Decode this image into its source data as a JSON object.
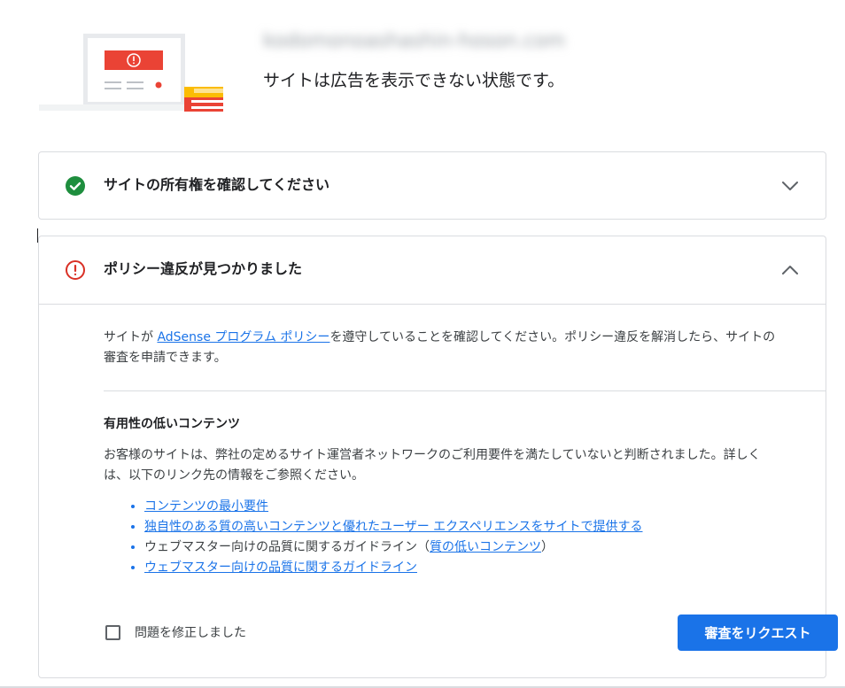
{
  "header": {
    "site_domain": "kodomonoashashin-hoson.com",
    "status_message": "サイトは広告を表示できない状態です。",
    "illustration_icon": "monitor-warning-icon"
  },
  "cards": {
    "ownership": {
      "title": "サイトの所有権を確認してください",
      "status": "complete",
      "status_icon": "check-circle-icon",
      "status_color": "#1e8e3e",
      "expanded": false
    },
    "policy": {
      "title": "ポリシー違反が見つかりました",
      "status": "error",
      "status_icon": "error-circle-icon",
      "status_color": "#d93025",
      "expanded": true,
      "intro_before": "サイトが ",
      "intro_link": "AdSense プログラム ポリシー",
      "intro_after": "を遵守していることを確認してください。ポリシー違反を解消したら、サイトの審査を申請できます。",
      "issue_title": "有用性の低いコンテンツ",
      "issue_description": "お客様のサイトは、弊社の定めるサイト運営者ネットワークのご利用要件を満たしていないと判断されました。詳しくは、以下のリンク先の情報をご参照ください。",
      "references": [
        {
          "link": "コンテンツの最小要件"
        },
        {
          "link": "独自性のある質の高いコンテンツと優れたユーザー エクスペリエンスをサイトで提供する"
        },
        {
          "prefix": "ウェブマスター向けの品質に関するガイドライン（",
          "link": "質の低いコンテンツ",
          "suffix": "）"
        },
        {
          "link": "ウェブマスター向けの品質に関するガイドライン"
        }
      ],
      "checkbox_label": "問題を修正しました",
      "checkbox_checked": false,
      "request_button": "審査をリクエスト"
    }
  },
  "colors": {
    "accent": "#1a73e8",
    "success": "#1e8e3e",
    "error": "#d93025",
    "border": "#dadce0"
  }
}
